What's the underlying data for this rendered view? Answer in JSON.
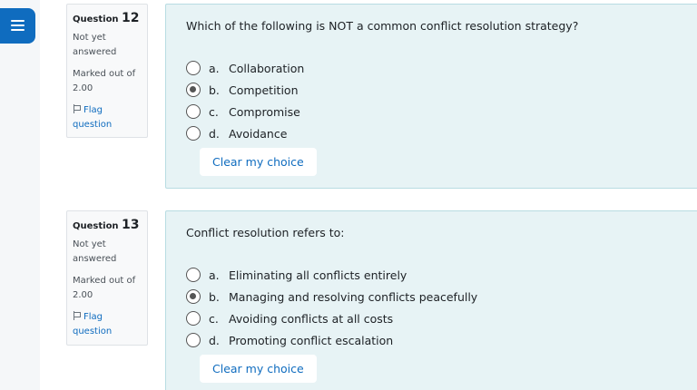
{
  "nav": {
    "drawer_toggle_icon": "hamburger-menu-icon"
  },
  "questions": [
    {
      "label": "Question",
      "number": "12",
      "state": "Not yet answered",
      "grade": "Marked out of 2.00",
      "flag_label": "Flag question",
      "text": "Which of the following is NOT a common conflict resolution strategy?",
      "options": [
        {
          "letter": "a.",
          "text": "Collaboration",
          "selected": false
        },
        {
          "letter": "b.",
          "text": "Competition",
          "selected": true
        },
        {
          "letter": "c.",
          "text": "Compromise",
          "selected": false
        },
        {
          "letter": "d.",
          "text": "Avoidance",
          "selected": false
        }
      ],
      "clear_label": "Clear my choice"
    },
    {
      "label": "Question",
      "number": "13",
      "state": "Not yet answered",
      "grade": "Marked out of 2.00",
      "flag_label": "Flag question",
      "text": "Conflict resolution refers to:",
      "options": [
        {
          "letter": "a.",
          "text": "Eliminating all conflicts entirely",
          "selected": false
        },
        {
          "letter": "b.",
          "text": "Managing and resolving conflicts peacefully",
          "selected": true
        },
        {
          "letter": "c.",
          "text": "Avoiding conflicts at all costs",
          "selected": false
        },
        {
          "letter": "d.",
          "text": "Promoting conflict escalation",
          "selected": false
        }
      ],
      "clear_label": "Clear my choice"
    }
  ],
  "colors": {
    "accent": "#0f6cbf",
    "content_bg": "#e7f3f5",
    "info_bg": "#f8f9fa"
  }
}
